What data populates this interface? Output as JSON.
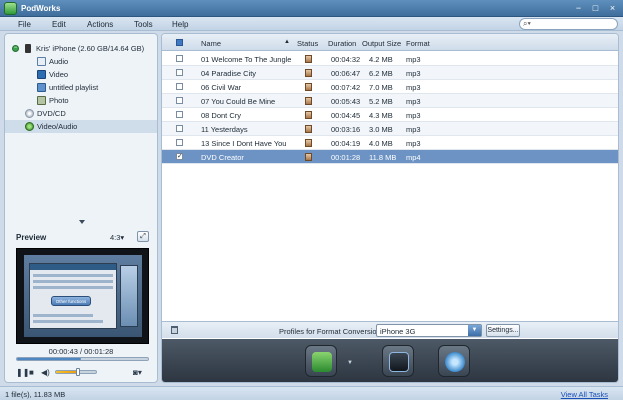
{
  "app": {
    "title": "PodWorks"
  },
  "window": {
    "minimize": "−",
    "maximize": "□",
    "close": "×"
  },
  "menu": [
    "File",
    "Edit",
    "Actions",
    "Tools",
    "Help"
  ],
  "search": {
    "placeholder": "",
    "icon": "search-icon"
  },
  "tree": {
    "device": "Kris' iPhone (2.60 GB/14.64 GB)",
    "items": [
      "Audio",
      "Video",
      "untitled playlist",
      "Photo"
    ],
    "dvd": "DVD/CD",
    "video_audio": "Video/Audio"
  },
  "preview": {
    "title": "Preview",
    "aspect": "4:3▾",
    "video_button_text": "Other functions",
    "time": "00:00:43 / 00:01:28",
    "progress": 0.49,
    "volume": 0.55
  },
  "table": {
    "columns": {
      "name": "Name",
      "status": "Status",
      "duration": "Duration",
      "output_size": "Output Size",
      "format": "Format"
    },
    "rows": [
      {
        "checked": false,
        "name": "01 Welcome To The Jungle",
        "duration": "00:04:32",
        "size": "4.2 MB",
        "format": "mp3"
      },
      {
        "checked": false,
        "name": "04 Paradise City",
        "duration": "00:06:47",
        "size": "6.2 MB",
        "format": "mp3"
      },
      {
        "checked": false,
        "name": "06 Civil War",
        "duration": "00:07:42",
        "size": "7.0 MB",
        "format": "mp3"
      },
      {
        "checked": false,
        "name": "07 You Could Be Mine",
        "duration": "00:05:43",
        "size": "5.2 MB",
        "format": "mp3"
      },
      {
        "checked": false,
        "name": "08 Dont Cry",
        "duration": "00:04:45",
        "size": "4.3 MB",
        "format": "mp3"
      },
      {
        "checked": false,
        "name": "11 Yesterdays",
        "duration": "00:03:16",
        "size": "3.0 MB",
        "format": "mp3"
      },
      {
        "checked": false,
        "name": "13 Since I Dont Have You",
        "duration": "00:04:19",
        "size": "4.0 MB",
        "format": "mp3"
      },
      {
        "checked": true,
        "name": "DVD Creator",
        "duration": "00:01:28",
        "size": "11.8 MB",
        "format": "mp4"
      }
    ]
  },
  "conversion": {
    "label": "Profiles for Format Conversion:",
    "profile": "iPhone 3G",
    "settings": "Settings..."
  },
  "statusbar": {
    "left": "1 file(s), 11.83 MB",
    "view_all": "View All Tasks"
  },
  "colors": {
    "accent": "#3f6e9d",
    "selected_row": "#6c93c4",
    "link": "#1a4fb8"
  }
}
